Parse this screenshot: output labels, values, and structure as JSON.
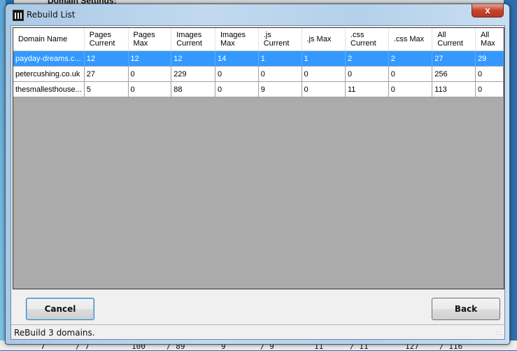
{
  "background": {
    "title": "Domain Settings:",
    "bottom_values": [
      "7",
      "/ 7",
      "100",
      "/ 89",
      "9",
      "/ 9",
      "11",
      "/ 11",
      "127",
      "/ 116"
    ]
  },
  "window": {
    "title": "Rebuild List",
    "icon": "app-icon",
    "close_label": "x"
  },
  "grid": {
    "columns": [
      "Domain Name",
      "Pages Current",
      "Pages Max",
      "Images Current",
      "Images Max",
      ".js Current",
      ".js Max",
      ".css Current",
      ".css Max",
      "All Current",
      "All Max"
    ],
    "rows": [
      [
        "payday-dreams.c...",
        "12",
        "12",
        "12",
        "14",
        "1",
        "1",
        "2",
        "2",
        "27",
        "29"
      ],
      [
        "petercushing.co.uk",
        "27",
        "0",
        "229",
        "0",
        "0",
        "0",
        "0",
        "0",
        "256",
        "0"
      ],
      [
        "thesmallesthouse...",
        "5",
        "0",
        "88",
        "0",
        "9",
        "0",
        "11",
        "0",
        "113",
        "0"
      ]
    ],
    "selected_row": 0
  },
  "buttons": {
    "cancel": "Cancel",
    "back": "Back"
  },
  "status": {
    "text": "ReBuild 3 domains."
  },
  "colors": {
    "selection": "#3399ff",
    "grid_background": "#ababab"
  }
}
